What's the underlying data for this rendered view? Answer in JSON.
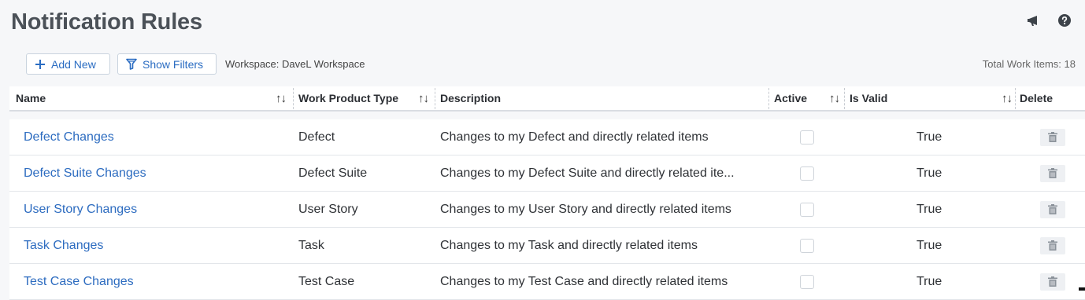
{
  "page": {
    "title": "Notification Rules"
  },
  "toolbar": {
    "add_label": "Add New",
    "filter_label": "Show Filters",
    "workspace": "Workspace: DaveL Workspace",
    "total": "Total Work Items: 18"
  },
  "columns": {
    "name": "Name",
    "type": "Work Product Type",
    "description": "Description",
    "active": "Active",
    "valid": "Is Valid",
    "delete": "Delete",
    "sort_glyph": "↑↓"
  },
  "rows": [
    {
      "name": "Defect Changes",
      "type": "Defect",
      "description": "Changes to my Defect and directly related items",
      "active": false,
      "valid": "True"
    },
    {
      "name": "Defect Suite Changes",
      "type": "Defect Suite",
      "description": "Changes to my Defect Suite and directly related ite...",
      "active": false,
      "valid": "True"
    },
    {
      "name": "User Story Changes",
      "type": "User Story",
      "description": "Changes to my User Story and directly related items",
      "active": false,
      "valid": "True"
    },
    {
      "name": "Task Changes",
      "type": "Task",
      "description": "Changes to my Task and directly related items",
      "active": false,
      "valid": "True"
    },
    {
      "name": "Test Case Changes",
      "type": "Test Case",
      "description": "Changes to my Test Case and directly related items",
      "active": false,
      "valid": "True"
    }
  ],
  "icons": {
    "announcement": "megaphone-icon",
    "help": "help-icon",
    "add": "plus-icon",
    "filter": "filter-icon",
    "delete": "trash-icon"
  },
  "colors": {
    "link": "#2d6cc0",
    "title": "#4b5158",
    "background": "#f6f7f9"
  }
}
